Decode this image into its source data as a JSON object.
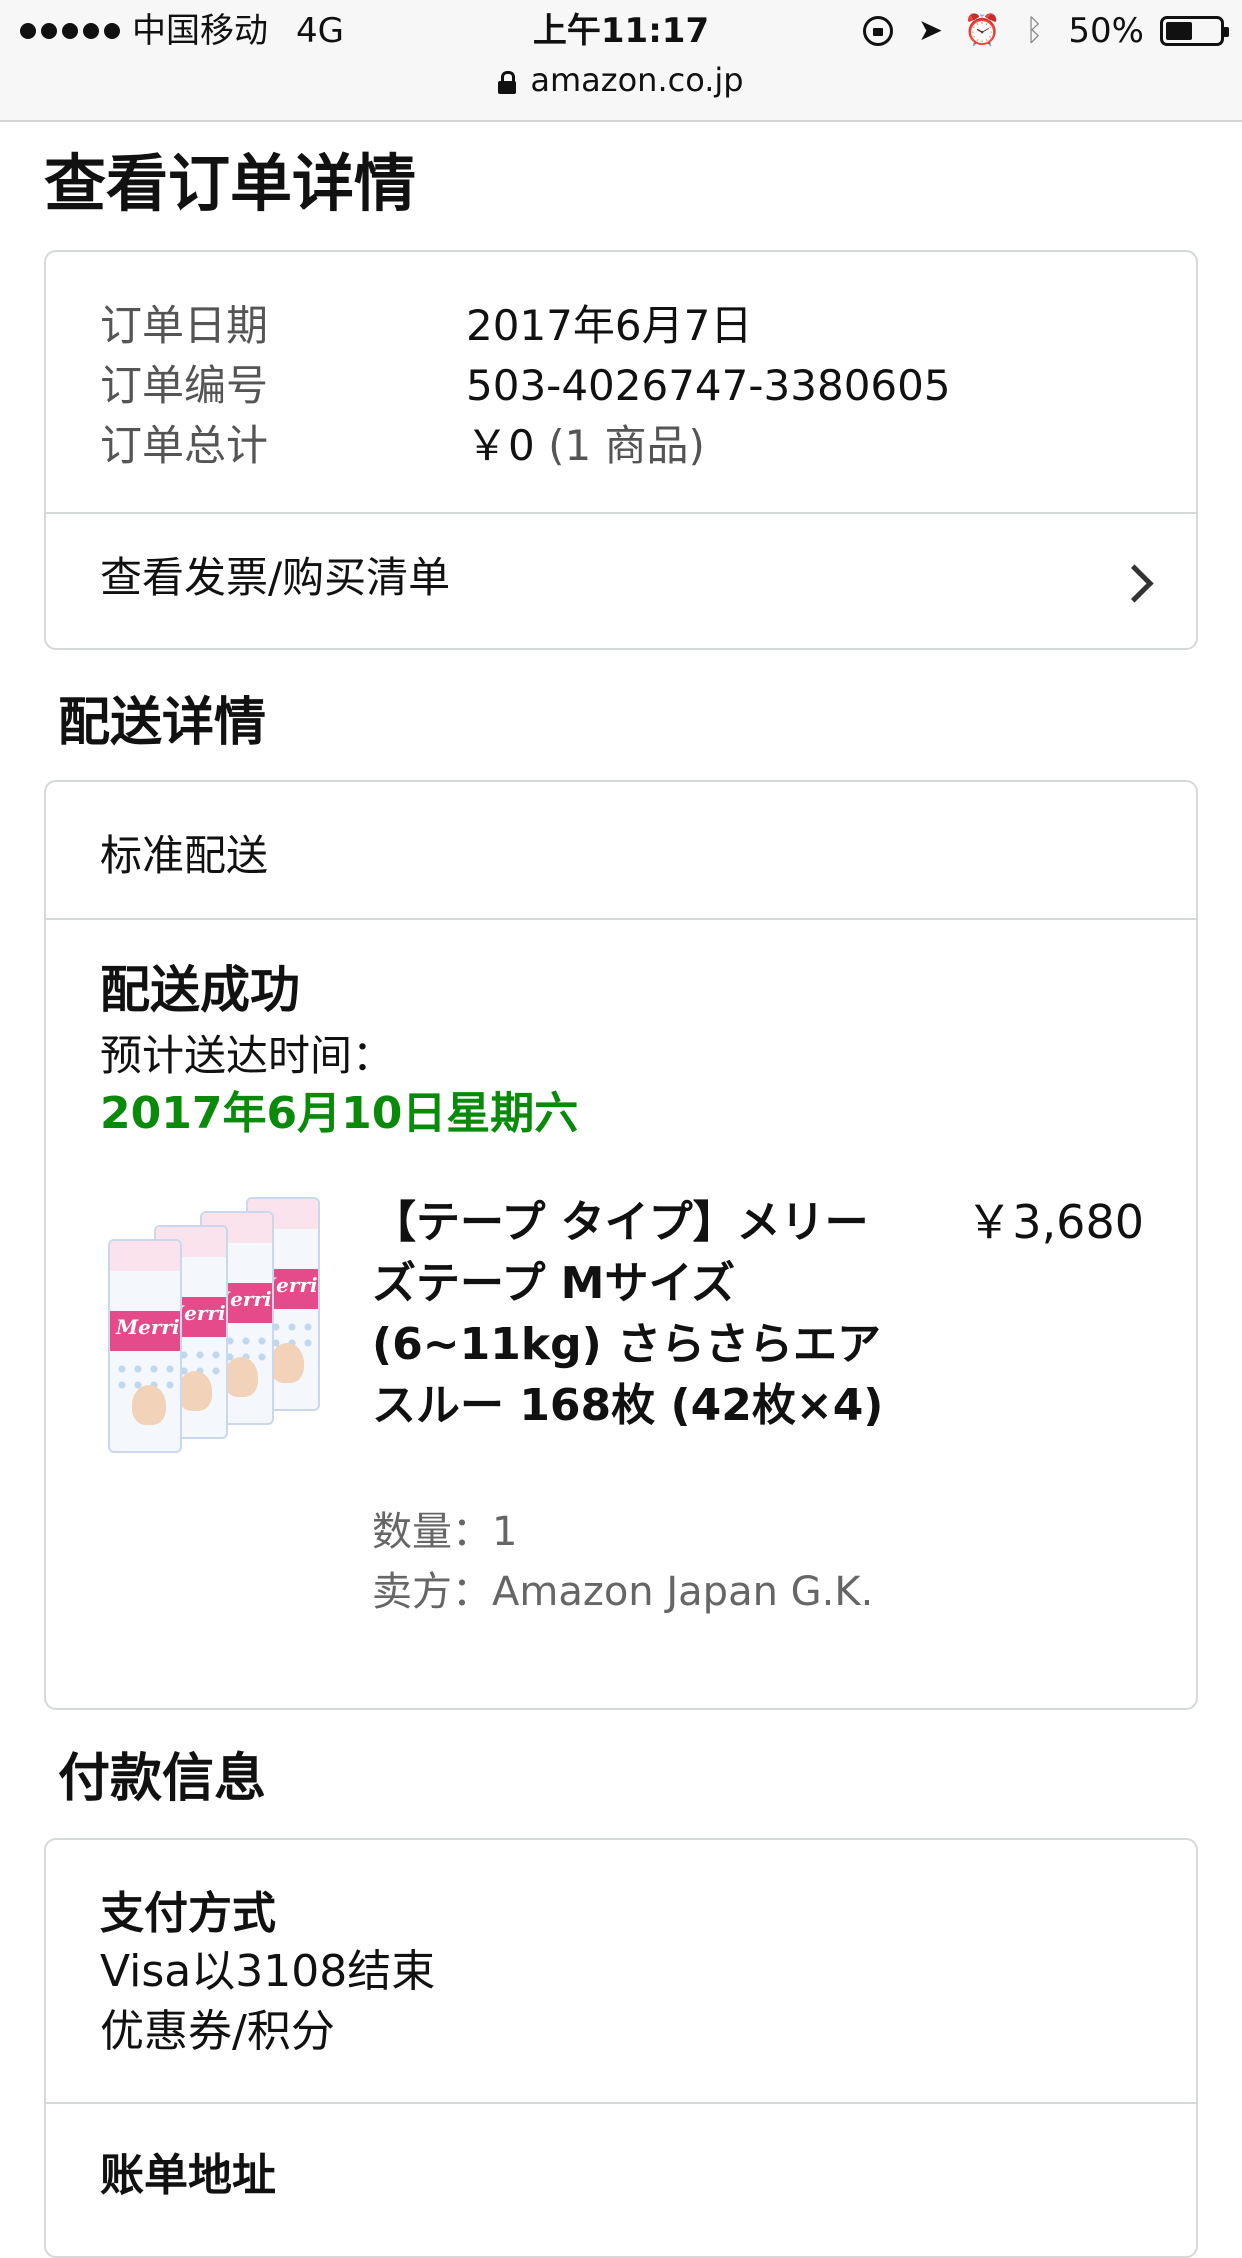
{
  "status_bar": {
    "carrier": "中国移动",
    "network": "4G",
    "time": "上午11:17",
    "battery": "50%",
    "battery_level": 0.5,
    "icons": [
      "orientation-lock-icon",
      "location-arrow-icon",
      "alarm-icon",
      "bluetooth-icon",
      "battery-icon"
    ]
  },
  "url_bar": {
    "domain": "amazon.co.jp",
    "icon": "padlock-icon"
  },
  "page": {
    "title": "查看订单详情"
  },
  "summary": {
    "rows": [
      {
        "label": "订单日期",
        "value": "2017年6月7日"
      },
      {
        "label": "订单编号",
        "value": "503-4026747-3380605"
      },
      {
        "label": "订单总计",
        "value": "￥0",
        "suffix": "(1 商品)"
      }
    ],
    "invoice_link": "查看发票/购买清单"
  },
  "shipping": {
    "heading": "配送详情",
    "method": "标准配送",
    "status": "配送成功",
    "eta_label": "预计送达时间：",
    "eta_value": "2017年6月10日星期六",
    "item": {
      "image_brand": "Merries",
      "title": "【テープ タイプ】メリーズテープ Mサイズ (6~11kg) さらさらエアスルー 168枚 (42枚×4)",
      "price": "￥3,680",
      "quantity": "数量：1",
      "seller": "卖方：Amazon Japan G.K."
    }
  },
  "payment": {
    "heading": "付款信息",
    "method_label": "支付方式",
    "method_value": "Visa以3108结束",
    "coupon": "优惠券/积分",
    "billing_label": "账单地址"
  },
  "colors": {
    "eta": "#0a8a0a",
    "border": "#d5d9d9",
    "topbar": "#f7f7f7"
  }
}
